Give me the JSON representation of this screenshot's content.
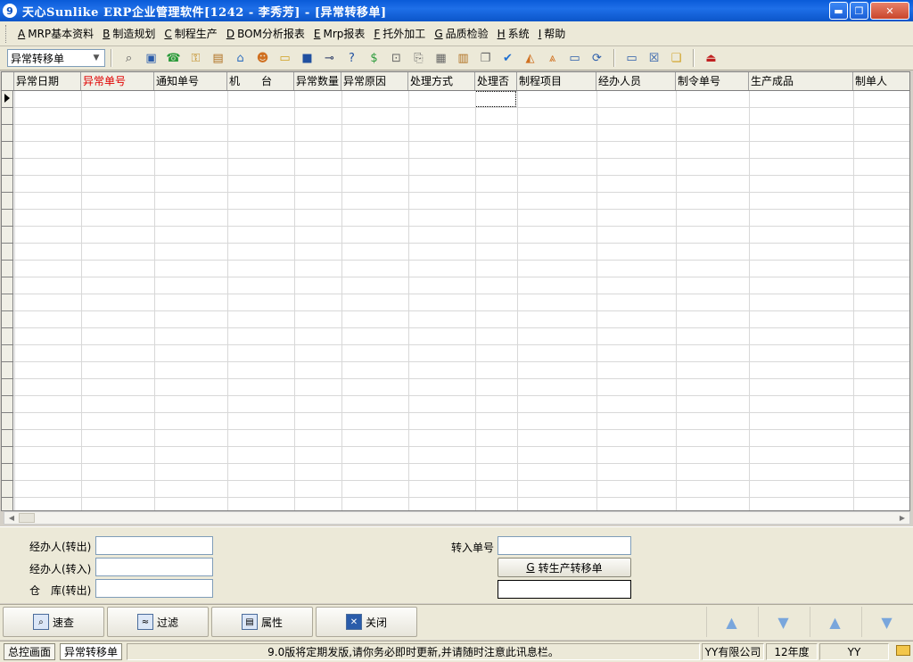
{
  "window": {
    "icon_glyph": "9",
    "title": "天心Sunlike ERP企业管理软件[1242 - 李秀芳] - [异常转移单]",
    "minimize": "▬",
    "restore": "❐",
    "close": "✕"
  },
  "menu": [
    {
      "key": "A",
      "label": "MRP基本资料"
    },
    {
      "key": "B",
      "label": "制造规划"
    },
    {
      "key": "C",
      "label": "制程生产"
    },
    {
      "key": "D",
      "label": "BOM分析报表"
    },
    {
      "key": "E",
      "label": "Mrp报表"
    },
    {
      "key": "F",
      "label": "托外加工"
    },
    {
      "key": "G",
      "label": "品质检验"
    },
    {
      "key": "H",
      "label": "系统"
    },
    {
      "key": "I",
      "label": "帮助"
    }
  ],
  "toolbar": {
    "combo_value": "异常转移单",
    "icons": [
      "find-icon",
      "computer-icon",
      "phone-icon",
      "lock-icon",
      "briefcase-icon",
      "home-icon",
      "users-icon",
      "folder-icon",
      "bookmark-icon",
      "pin-icon",
      "help-icon",
      "money-icon",
      "cart-icon",
      "document-icon",
      "calculator-icon",
      "cabinet-icon",
      "copy-icon",
      "check-icon",
      "bell-icon",
      "hierarchy-icon",
      "monitor-icon",
      "refresh-icon",
      "window-icon",
      "close-window-icon",
      "cascade-icon",
      "exit-icon"
    ]
  },
  "grid": {
    "columns": [
      "异常日期",
      "异常单号",
      "通知单号",
      "机　　台",
      "异常数量",
      "异常原因",
      "处理方式",
      "处理否",
      "制程项目",
      "经办人员",
      "制令单号",
      "生产成品",
      "制单人"
    ],
    "required_column": "异常单号",
    "rows": []
  },
  "form": {
    "handler_out_label": "经办人(转出)",
    "handler_out_value": "",
    "handler_in_label": "经办人(转入)",
    "handler_in_value": "",
    "warehouse_out_label": "仓　库(转出)",
    "warehouse_out_value": "",
    "transfer_no_label": "转入单号",
    "transfer_no_value": "",
    "convert_button": "转生产转移单",
    "convert_button_key": "G",
    "extra_value": ""
  },
  "actions": {
    "quick_search": "速查",
    "filter": "过滤",
    "properties": "属性",
    "close": "关闭",
    "nav_first": "▲",
    "nav_down": "▼",
    "nav_up": "▲",
    "nav_last": "▼"
  },
  "status": {
    "tab_home": "总控画面",
    "tab_current": "异常转移单",
    "message": "9.0版将定期发版,请你务必即时更新,并请随时注意此讯息栏。",
    "company": "YY有限公司",
    "year": "12年度",
    "user": "YY"
  },
  "colors": {
    "title_bar": "#0a5bd8",
    "required_header": "#e00000",
    "nav_arrow": "#79a6dc"
  }
}
